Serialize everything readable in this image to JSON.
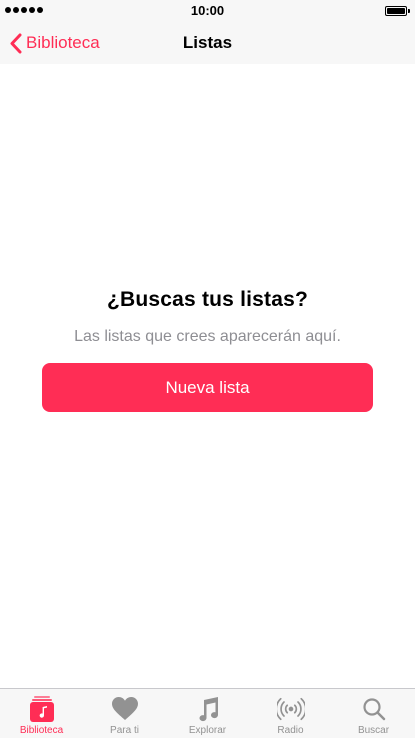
{
  "status_bar": {
    "time": "10:00"
  },
  "nav": {
    "back_label": "Biblioteca",
    "title": "Listas"
  },
  "empty_state": {
    "heading": "¿Buscas tus listas?",
    "subtitle": "Las listas que crees aparecerán aquí.",
    "button_label": "Nueva lista"
  },
  "tab_bar": {
    "tabs": [
      {
        "label": "Biblioteca",
        "icon": "library-icon",
        "active": true
      },
      {
        "label": "Para ti",
        "icon": "heart-icon",
        "active": false
      },
      {
        "label": "Explorar",
        "icon": "music-note-icon",
        "active": false
      },
      {
        "label": "Radio",
        "icon": "radio-icon",
        "active": false
      },
      {
        "label": "Buscar",
        "icon": "search-icon",
        "active": false
      }
    ]
  },
  "colors": {
    "accent": "#ff2d55",
    "inactive": "#929292",
    "bar_background": "#f7f7f7"
  }
}
